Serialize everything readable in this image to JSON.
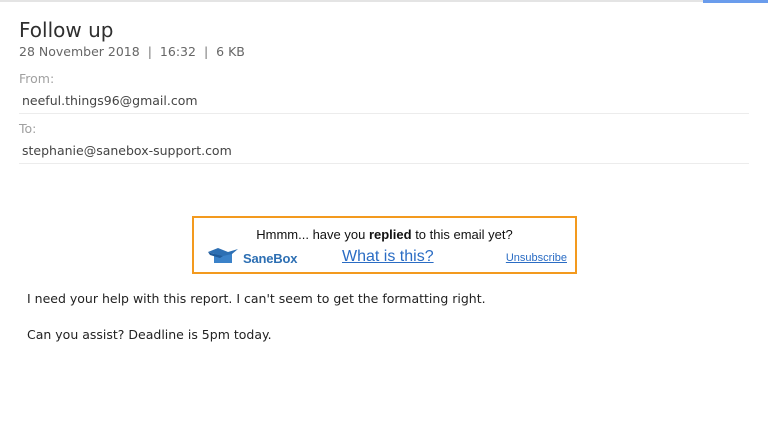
{
  "email": {
    "subject": "Follow up",
    "date": "28 November 2018",
    "time": "16:32",
    "size": "6 KB",
    "separator": "|",
    "from_label": "From:",
    "from_value": "neeful.things96@gmail.com",
    "to_label": "To:",
    "to_value": "stephanie@sanebox-support.com"
  },
  "sanebox": {
    "question_prefix": "Hmmm... have you ",
    "question_bold": "replied",
    "question_suffix": " to this email yet?",
    "logo_text": "SaneBox",
    "what_link": "What is this?",
    "unsubscribe_link": "Unsubscribe",
    "border_color": "#f39a1e",
    "link_color": "#2a6cc4",
    "logo_color": "#2d6fb3",
    "logo_icon": "box-icon"
  },
  "body": {
    "paragraphs": [
      "I need your help with this report. I can't seem to get the formatting right.",
      "Can you assist? Deadline is 5pm today."
    ]
  }
}
